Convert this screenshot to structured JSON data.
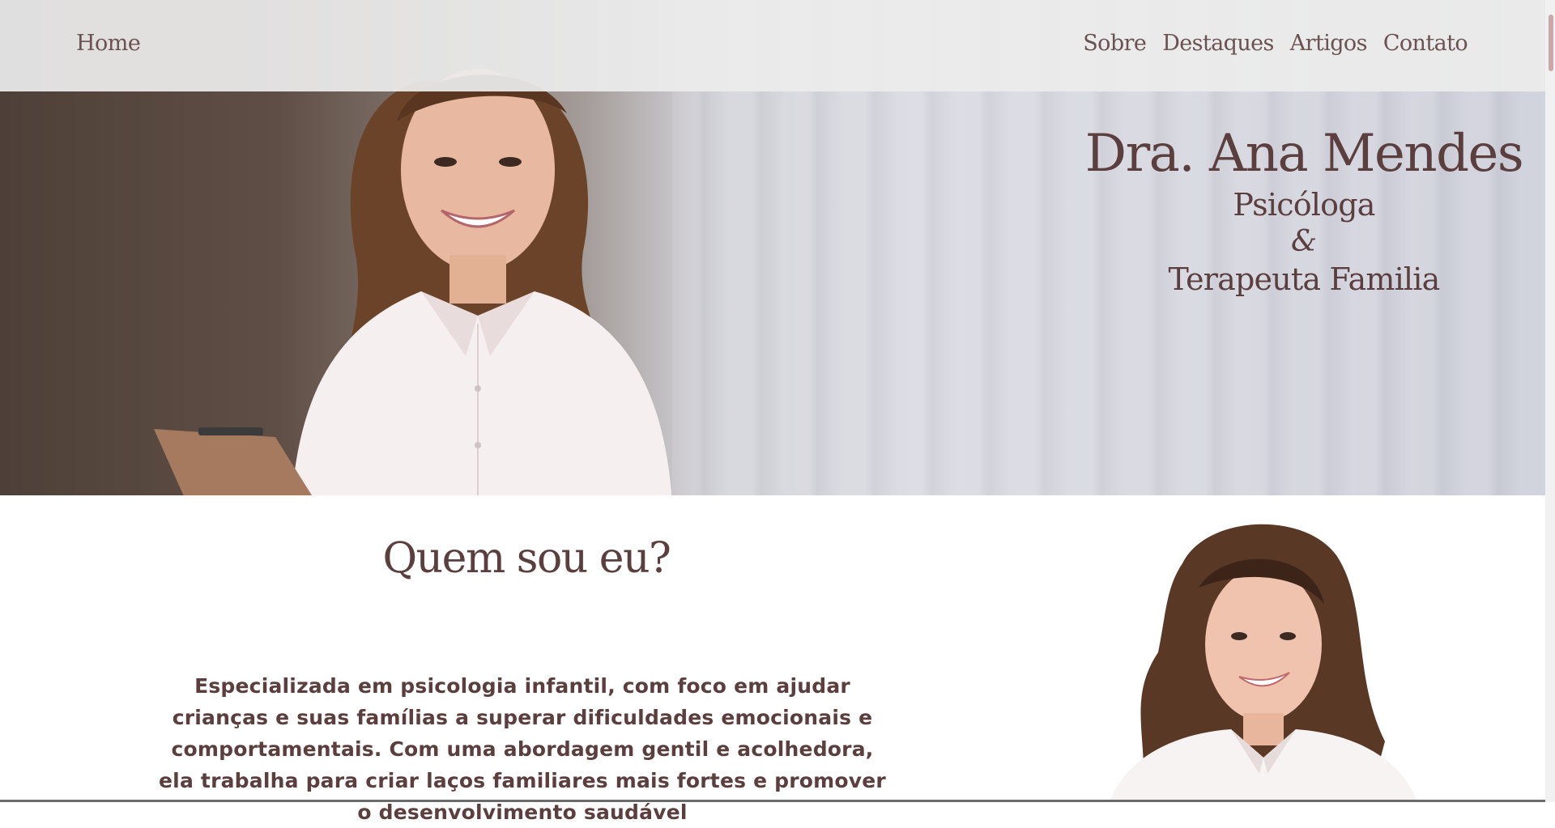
{
  "nav": {
    "home": "Home",
    "links": [
      "Sobre",
      "Destaques",
      "Artigos",
      "Contato"
    ]
  },
  "hero": {
    "name": "Dra. Ana Mendes",
    "role_line1": "Psicóloga",
    "ampersand": "&",
    "role_line2": "Terapeuta Familia"
  },
  "about": {
    "title": "Quem sou eu?",
    "text": "Especializada em psicologia infantil, com foco em ajudar crianças e suas famílias a superar dificuldades emocionais e comportamentais. Com uma abordagem gentil e acolhedora, ela trabalha para criar laços familiares mais fortes e promover o desenvolvimento saudável"
  },
  "colors": {
    "accent": "#5b3e3e",
    "nav_bg": "#ececec",
    "scroll_thumb": "#c8a8ac"
  }
}
